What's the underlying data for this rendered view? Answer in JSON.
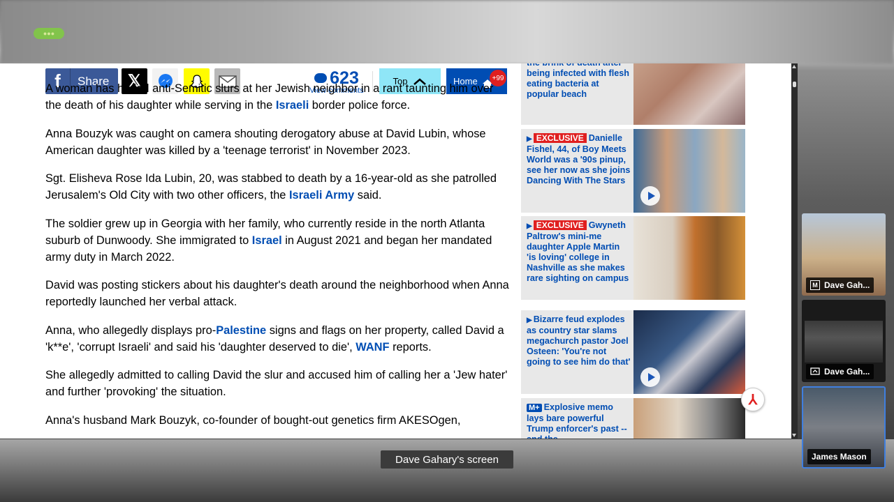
{
  "toolbar": {
    "share_label": "Share",
    "comment_count": "623",
    "view_comments_label": "View comments",
    "top_label": "Top",
    "home_label": "Home",
    "home_badge": "+99",
    "colors": {
      "facebook": "#3b5998",
      "x": "#000000",
      "snapchat": "#fffc00",
      "top": "#8fe6f7",
      "home": "#004db3"
    }
  },
  "article": {
    "paragraphs": [
      {
        "parts": [
          "A woman has hurled anti-Semitic slurs at her Jewish neighbor in a rant taunting him over the death of his daughter while serving in the ",
          "Israeli",
          " border police force."
        ]
      },
      {
        "text": "Anna Bouzyk was caught on camera shouting derogatory abuse at David Lubin, whose American daughter was killed by a 'teenage terrorist' in November 2023."
      },
      {
        "parts": [
          "Sgt. Elisheva Rose Ida Lubin, 20, was stabbed to death by a 16-year-old as she patrolled Jerusalem's Old City with two other officers, the ",
          "Israeli Army",
          " said."
        ]
      },
      {
        "parts": [
          "The soldier grew up in Georgia with her family, who currently reside in the north Atlanta suburb of Dunwoody. She immigrated to ",
          "Israel",
          " in August 2021 and began her mandated army duty in March 2022."
        ]
      },
      {
        "text": "David was posting stickers about his daughter's death around the neighborhood when Anna reportedly launched her verbal attack."
      },
      {
        "parts": [
          "Anna, who allegedly displays pro-",
          "Palestine",
          " signs and flags on her property, called David a 'k**e', 'corrupt Israeli' and said his 'daughter deserved to die', ",
          "WANF",
          " reports."
        ]
      },
      {
        "text": "She allegedly admitted to calling David the slur and accused him of calling her a 'Jew hater' and further 'provoking' the situation."
      },
      {
        "text": "Anna's husband Mark Bouzyk, co-founder of bought-out genetics firm AKESOgen,"
      }
    ]
  },
  "sidebar": {
    "cards": [
      {
        "text": "the brink of death after being infected with flesh eating bacteria at popular beach"
      },
      {
        "badge": "EXCLUSIVE",
        "text": "Danielle Fishel, 44, of Boy Meets World was a '90s pinup, see her now as she joins Dancing With The Stars"
      },
      {
        "badge": "EXCLUSIVE",
        "text": "Gwyneth Paltrow's mini-me daughter Apple Martin 'is loving' college in Nashville as she makes rare sighting on campus"
      },
      {
        "text": "Bizarre feud explodes as country star slams megachurch pastor Joel Osteen: 'You're not going to see him do that'"
      },
      {
        "badge": "M+",
        "text": "Explosive memo lays bare powerful Trump enforcer's past -- and the"
      }
    ]
  },
  "meeting": {
    "screen_label": "Dave Gahary's screen",
    "participants": [
      {
        "name": "Dave Gah...",
        "icon": "m-badge-icon"
      },
      {
        "name": "Dave Gah...",
        "icon": "screen-share-icon"
      },
      {
        "name": "James Mason",
        "icon": ""
      }
    ]
  }
}
